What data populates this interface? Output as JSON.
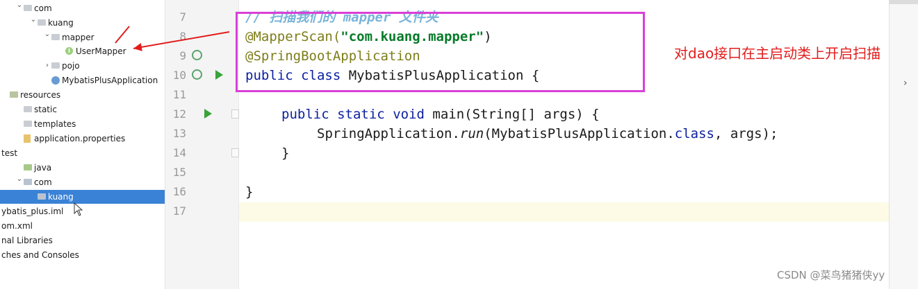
{
  "tree": [
    {
      "label": "com",
      "indent": 1,
      "arrow": "v",
      "icon": "folder"
    },
    {
      "label": "kuang",
      "indent": 2,
      "arrow": "v",
      "icon": "folder"
    },
    {
      "label": "mapper",
      "indent": 3,
      "arrow": "v",
      "icon": "folder"
    },
    {
      "label": "UserMapper",
      "indent": 4,
      "arrow": "",
      "icon": "interface"
    },
    {
      "label": "pojo",
      "indent": 3,
      "arrow": ">",
      "icon": "folder"
    },
    {
      "label": "MybatisPlusApplication",
      "indent": 3,
      "arrow": "",
      "icon": "app"
    },
    {
      "label": "resources",
      "indent": 0,
      "arrow": "",
      "icon": "res"
    },
    {
      "label": "static",
      "indent": 1,
      "arrow": "",
      "icon": "folder"
    },
    {
      "label": "templates",
      "indent": 1,
      "arrow": "",
      "icon": "folder"
    },
    {
      "label": "application.properties",
      "indent": 1,
      "arrow": "",
      "icon": "file"
    },
    {
      "label": "test",
      "indent": 0,
      "arrow": "",
      "icon": "none"
    },
    {
      "label": "java",
      "indent": 1,
      "arrow": "",
      "icon": "green"
    },
    {
      "label": "com",
      "indent": 1,
      "arrow": "v",
      "icon": "pkg"
    },
    {
      "label": "kuang",
      "indent": 2,
      "arrow": "",
      "icon": "pkg",
      "selected": true
    },
    {
      "label": "ybatis_plus.iml",
      "indent": 0,
      "arrow": "",
      "icon": "none"
    },
    {
      "label": "om.xml",
      "indent": 0,
      "arrow": "",
      "icon": "none"
    },
    {
      "label": "nal Libraries",
      "indent": 0,
      "arrow": "",
      "icon": "none"
    },
    {
      "label": "ches and Consoles",
      "indent": 0,
      "arrow": "",
      "icon": "none"
    }
  ],
  "line_numbers": [
    "7",
    "8",
    "9",
    "10",
    "11",
    "12",
    "13",
    "14",
    "15",
    "16",
    "17"
  ],
  "code": {
    "l7": {
      "comment": "// 扫描我们的 mapper 文件夹"
    },
    "l8": {
      "ann": "@MapperScan(",
      "str": "\"com.kuang.mapper\"",
      "close": ")"
    },
    "l9": {
      "ann": "@SpringBootApplication"
    },
    "l10": {
      "kw1": "public",
      "kw2": "class",
      "rest": " MybatisPlusApplication {"
    },
    "l12": {
      "kw1": "public",
      "kw2": "static",
      "kw3": "void",
      "rest": " main(String[] args) {"
    },
    "l13": {
      "pre": "SpringApplication.",
      "run": "run",
      "mid": "(MybatisPlusApplication.",
      "cls": "class",
      "post": ", args);"
    },
    "l14": {
      "text": "}"
    },
    "l16": {
      "text": "}"
    }
  },
  "note": "对dao接口在主启动类上开启扫描",
  "watermark": "CSDN @菜鸟猪猪侠yy",
  "colors": {
    "highlight_box": "#d93fd6",
    "arrow": "#e21c1c",
    "note": "#e21c1c",
    "selection": "#3a82d6"
  }
}
